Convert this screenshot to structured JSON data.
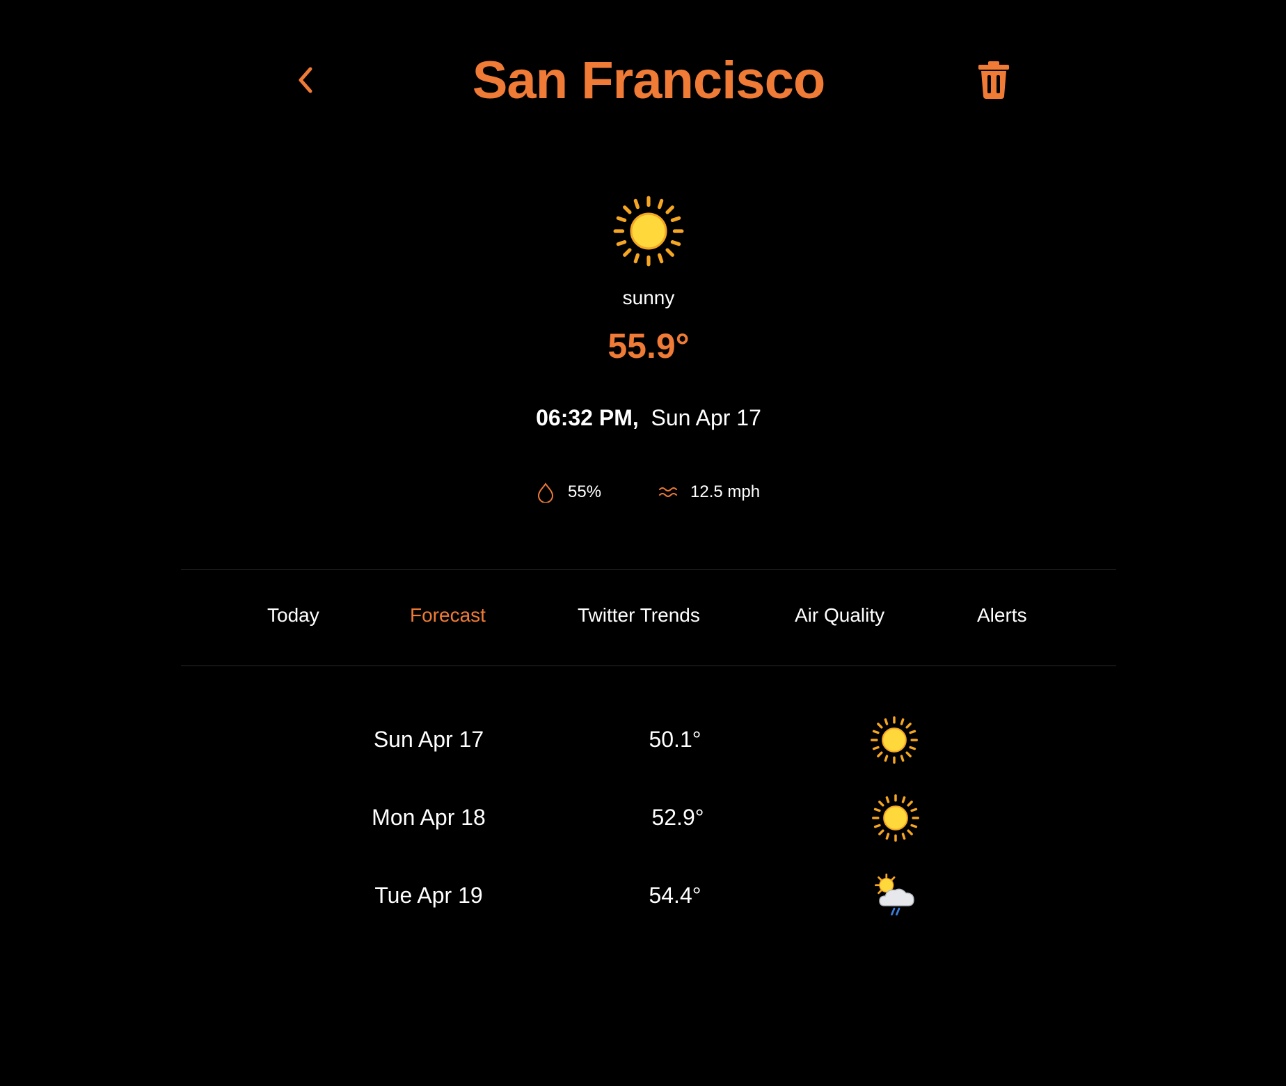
{
  "header": {
    "title": "San Francisco",
    "back_icon": "chevron-left-icon",
    "delete_icon": "trash-icon"
  },
  "current": {
    "icon": "sun-icon",
    "condition": "sunny",
    "temperature": "55.9°",
    "time": "06:32 PM,",
    "date": "Sun Apr 17",
    "humidity": "55%",
    "humidity_icon": "droplet-icon",
    "wind": "12.5 mph",
    "wind_icon": "wind-icon"
  },
  "tabs": [
    {
      "label": "Today",
      "active": false
    },
    {
      "label": "Forecast",
      "active": true
    },
    {
      "label": "Twitter Trends",
      "active": false
    },
    {
      "label": "Air Quality",
      "active": false
    },
    {
      "label": "Alerts",
      "active": false
    }
  ],
  "forecast": [
    {
      "day": "Sun Apr 17",
      "temp": "50.1°",
      "icon": "sun-icon"
    },
    {
      "day": "Mon Apr 18",
      "temp": "52.9°",
      "icon": "sun-icon"
    },
    {
      "day": "Tue Apr 19",
      "temp": "54.4°",
      "icon": "sun-behind-rain-cloud-icon"
    }
  ],
  "colors": {
    "accent": "#EF7B36",
    "background": "#000000",
    "text": "#FFFFFF",
    "divider": "#2A2A2A"
  }
}
